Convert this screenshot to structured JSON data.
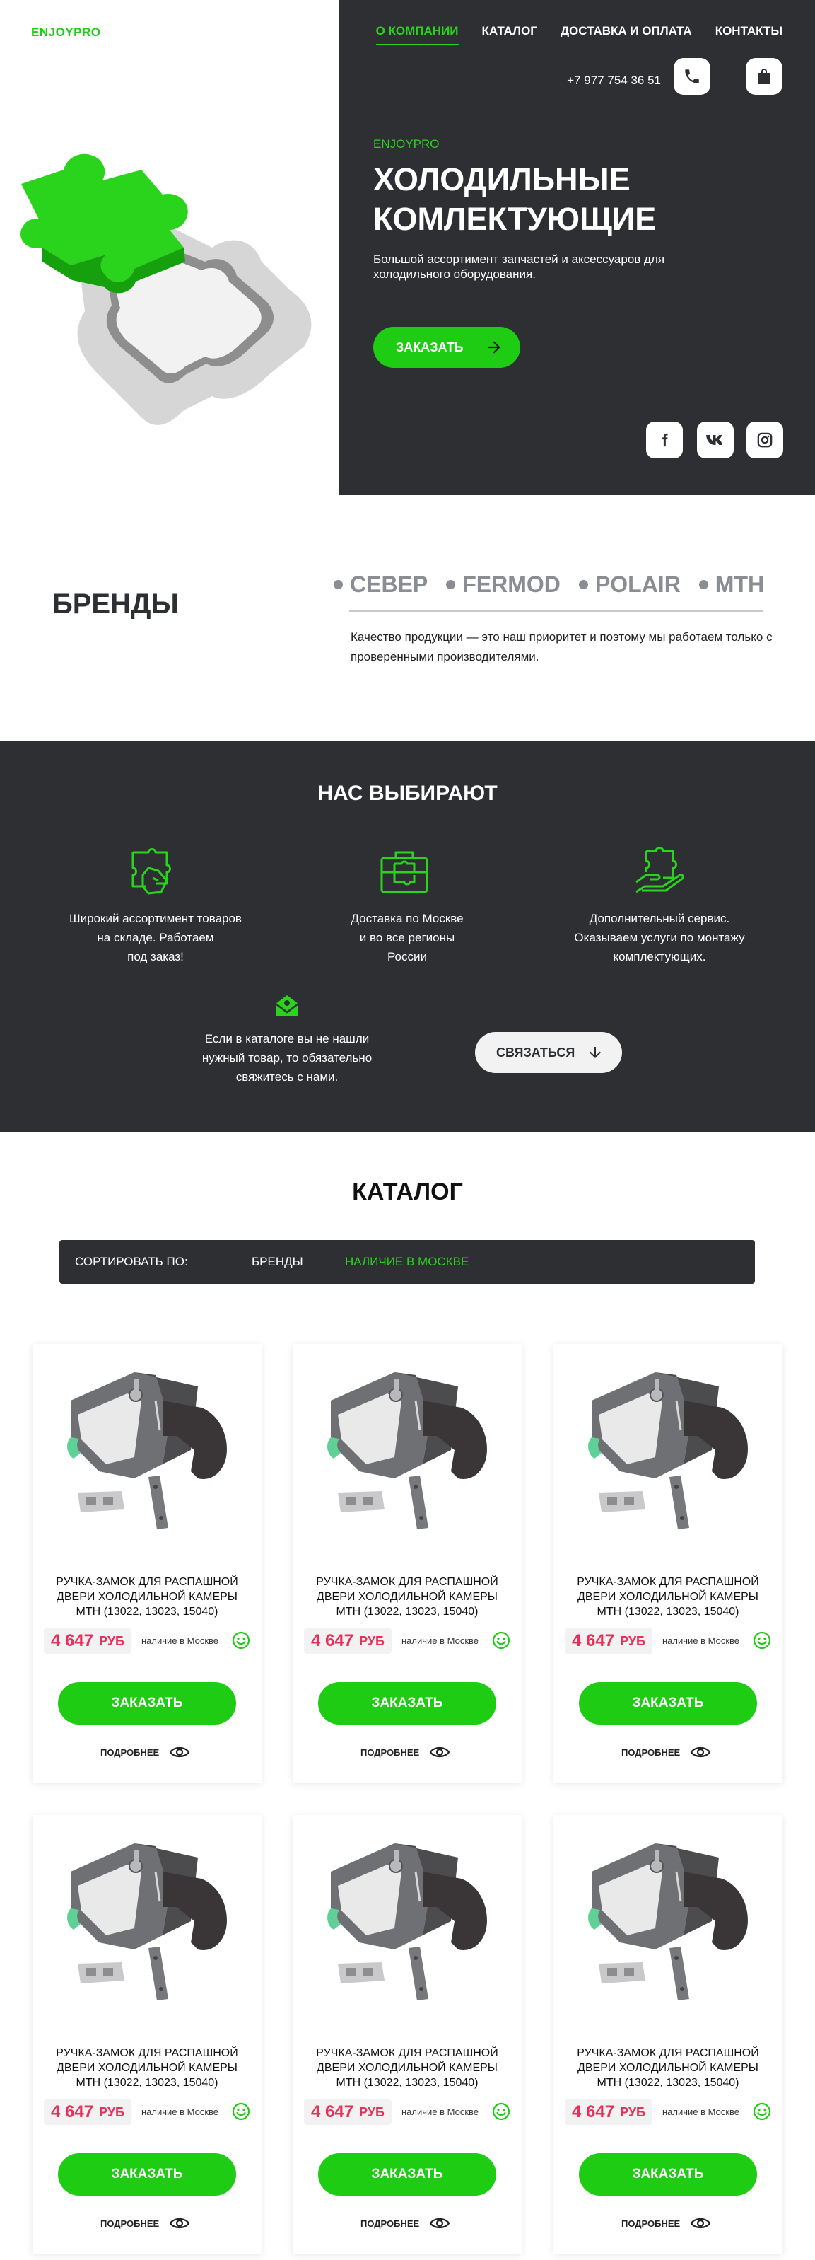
{
  "header": {
    "logo": "ENJOYPRO",
    "nav": [
      {
        "label": "О КОМПАНИИ"
      },
      {
        "label": "КАТАЛОГ"
      },
      {
        "label": "ДОСТАВКА И ОПЛАТА"
      },
      {
        "label": "КОНТАКТЫ"
      }
    ],
    "phone": "+7 977 754 36 51"
  },
  "hero": {
    "brand": "ENJOYPRO",
    "title": "ХОЛОДИЛЬНЫЕ КОМЛЕКТУЮЩИЕ",
    "subtitle": "Большой ассортимент запчастей и аксессуаров для холодильного оборудования.",
    "order_label": "ЗАКАЗАТЬ"
  },
  "brands": {
    "title": "БРЕНДЫ",
    "items": [
      "СЕВЕР",
      "FERMOD",
      "POLAIR",
      "MTH"
    ],
    "text": "Качество продукции — это наш приоритет и поэтому мы работаем только с проверенными производителями."
  },
  "choose": {
    "title": "НАС ВЫБИРАЮТ",
    "features": [
      {
        "text1": "Широкий ассортимент товаров",
        "text2": "на складе. Работаем",
        "text3": "под заказ!"
      },
      {
        "text1": "Доставка по Москве",
        "text2": "и во все регионы",
        "text3": "России"
      },
      {
        "text1": "Дополнительный сервис.",
        "text2": "Оказываем услуги по монтажу",
        "text3": "комплектующих."
      }
    ],
    "contact_text1": "Если в каталоге вы не нашли",
    "contact_text2": "нужный  товар, то обязательно",
    "contact_text3": "свяжитесь с нами.",
    "contact_button": "СВЯЗАТЬСЯ"
  },
  "catalog": {
    "title": "КАТАЛОГ",
    "sort_label": "СОРТИРОВАТЬ ПО:",
    "sort_brands": "БРЕНДЫ",
    "sort_stock": "НАЛИЧИЕ В МОСКВЕ",
    "products": [
      {
        "name1": "РУЧКА-ЗАМОК ДЛЯ РАСПАШНОЙ",
        "name2": "ДВЕРИ ХОЛОДИЛЬНОЙ КАМЕРЫ",
        "name3": "MTH (13022, 13023, 15040)",
        "price": "4 647",
        "currency": "РУБ",
        "stock": "наличие в Москве",
        "buy": "ЗАКАЗАТЬ",
        "more": "ПОДРОБНЕЕ"
      },
      {
        "name1": "РУЧКА-ЗАМОК ДЛЯ РАСПАШНОЙ",
        "name2": "ДВЕРИ ХОЛОДИЛЬНОЙ КАМЕРЫ",
        "name3": "MTH (13022, 13023, 15040)",
        "price": "4 647",
        "currency": "РУБ",
        "stock": "наличие в Москве",
        "buy": "ЗАКАЗАТЬ",
        "more": "ПОДРОБНЕЕ"
      },
      {
        "name1": "РУЧКА-ЗАМОК ДЛЯ РАСПАШНОЙ",
        "name2": "ДВЕРИ ХОЛОДИЛЬНОЙ КАМЕРЫ",
        "name3": "MTH (13022, 13023, 15040)",
        "price": "4 647",
        "currency": "РУБ",
        "stock": "наличие в Москве",
        "buy": "ЗАКАЗАТЬ",
        "more": "ПОДРОБНЕЕ"
      },
      {
        "name1": "РУЧКА-ЗАМОК ДЛЯ РАСПАШНОЙ",
        "name2": "ДВЕРИ ХОЛОДИЛЬНОЙ КАМЕРЫ",
        "name3": "MTH (13022, 13023, 15040)",
        "price": "4 647",
        "currency": "РУБ",
        "stock": "наличие в Москве",
        "buy": "ЗАКАЗАТЬ",
        "more": "ПОДРОБНЕЕ"
      },
      {
        "name1": "РУЧКА-ЗАМОК ДЛЯ РАСПАШНОЙ",
        "name2": "ДВЕРИ ХОЛОДИЛЬНОЙ КАМЕРЫ",
        "name3": "MTH (13022, 13023, 15040)",
        "price": "4 647",
        "currency": "РУБ",
        "stock": "наличие в Москве",
        "buy": "ЗАКАЗАТЬ",
        "more": "ПОДРОБНЕЕ"
      },
      {
        "name1": "РУЧКА-ЗАМОК ДЛЯ РАСПАШНОЙ",
        "name2": "ДВЕРИ ХОЛОДИЛЬНОЙ КАМЕРЫ",
        "name3": "MTH (13022, 13023, 15040)",
        "price": "4 647",
        "currency": "РУБ",
        "stock": "наличие в Москве",
        "buy": "ЗАКАЗАТЬ",
        "more": "ПОДРОБНЕЕ"
      }
    ]
  },
  "colors": {
    "accent": "#1fcc14",
    "dark": "#2d2f32",
    "price": "#e8305a"
  },
  "icons": [
    "phone-icon",
    "bag-icon",
    "arrow-right-icon",
    "facebook-icon",
    "vk-icon",
    "instagram-icon",
    "puzzle-hand-icon",
    "briefcase-puzzle-icon",
    "service-puzzle-icon",
    "mail-icon",
    "arrow-down-icon",
    "smile-icon",
    "eye-icon"
  ]
}
